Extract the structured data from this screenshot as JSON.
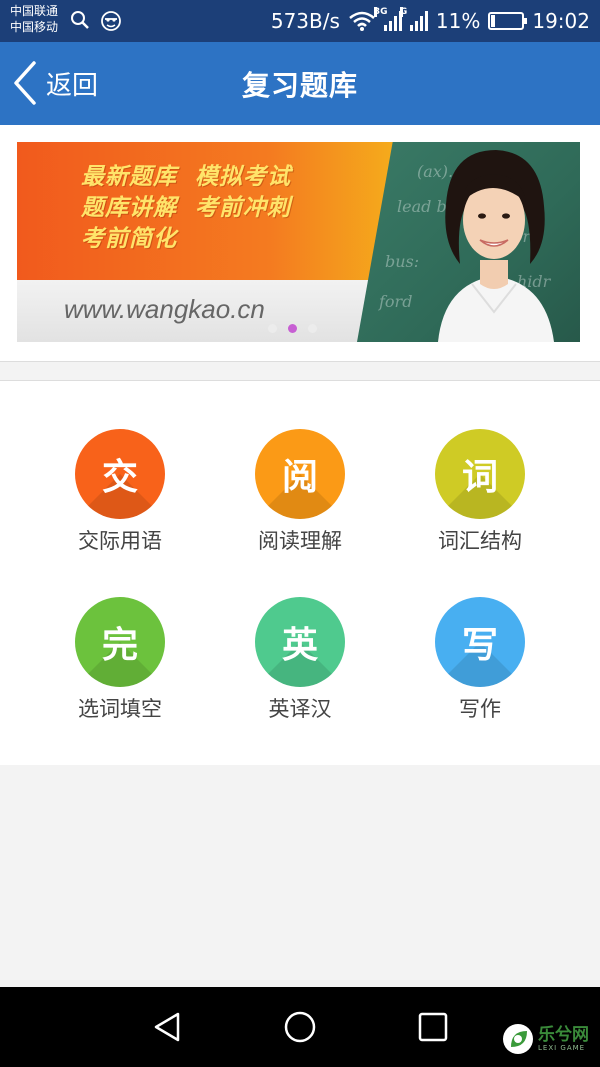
{
  "status_bar": {
    "carrier1": "中国联通",
    "carrier2": "中国移动",
    "network_speed": "573B/s",
    "sim1_type": "3G",
    "sim2_type": "G",
    "battery": "11%",
    "time": "19:02"
  },
  "header": {
    "back_label": "返回",
    "title": "复习题库"
  },
  "banner": {
    "slogan_line1": "最新题库  模拟考试",
    "slogan_line2": "题库讲解  考前冲刺",
    "slogan_line3": "考前简化",
    "url": "www.wangkao.cn",
    "board_lines": [
      "(ax).",
      "lead b",
      "fore",
      "bus:",
      "hidr",
      "ford"
    ],
    "active_dot": 2,
    "dot_count": 3
  },
  "menu": {
    "items": [
      {
        "glyph": "交",
        "label": "交际用语",
        "color": "#f8621a"
      },
      {
        "glyph": "阅",
        "label": "阅读理解",
        "color": "#fb9a16"
      },
      {
        "glyph": "词",
        "label": "词汇结构",
        "color": "#cfcb25"
      },
      {
        "glyph": "完",
        "label": "选词填空",
        "color": "#6cc23d"
      },
      {
        "glyph": "英",
        "label": "英译汉",
        "color": "#4fca8e"
      },
      {
        "glyph": "写",
        "label": "写作",
        "color": "#48aff1"
      }
    ]
  },
  "watermark": {
    "brand": "乐兮网",
    "sub": "LEXI GAME"
  }
}
